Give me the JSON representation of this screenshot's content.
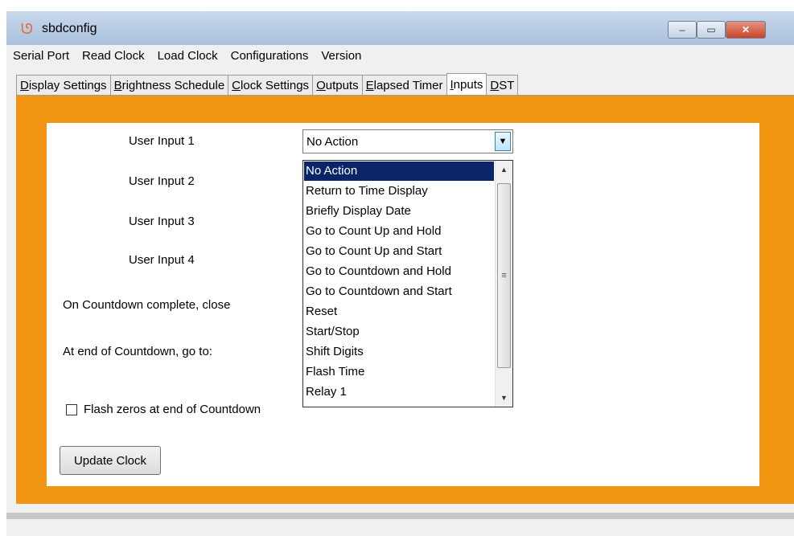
{
  "window": {
    "title": "sbdconfig",
    "icon": "sbd-logo-icon"
  },
  "controls": {
    "minimize": "–",
    "maximize": "▭",
    "close": "✕"
  },
  "menu": [
    "Serial Port",
    "Read Clock",
    "Load Clock",
    "Configurations",
    "Version"
  ],
  "tabs": [
    {
      "first": "D",
      "rest": "isplay Settings"
    },
    {
      "first": "B",
      "rest": "rightness Schedule"
    },
    {
      "first": "C",
      "rest": "lock Settings"
    },
    {
      "first": "O",
      "rest": "utputs"
    },
    {
      "first": "E",
      "rest": "lapsed Timer"
    },
    {
      "first": "I",
      "rest": "nputs"
    },
    {
      "first": "D",
      "rest": "ST"
    }
  ],
  "active_tab": "Inputs",
  "form": {
    "user_input_1": "User Input 1",
    "user_input_2": "User Input 2",
    "user_input_3": "User Input 3",
    "user_input_4": "User Input 4",
    "countdown_close": "On Countdown complete, close",
    "countdown_goto": "At end of Countdown, go to:",
    "flash_zeros": "Flash zeros at end of Countdown",
    "flash_zeros_checked": false,
    "update_button": "Update Clock"
  },
  "combo": {
    "value": "No Action",
    "options": [
      "No Action",
      "Return to Time Display",
      "Briefly Display Date",
      "Go to Count Up and Hold",
      "Go to Count Up and Start",
      "Go to Countdown and Hold",
      "Go to Countdown and Start",
      "Reset",
      "Start/Stop",
      "Shift Digits",
      "Flash Time",
      "Relay 1"
    ],
    "selected_index": 0
  },
  "colors": {
    "tab_background": "#f29513",
    "selection": "#0a246a"
  }
}
